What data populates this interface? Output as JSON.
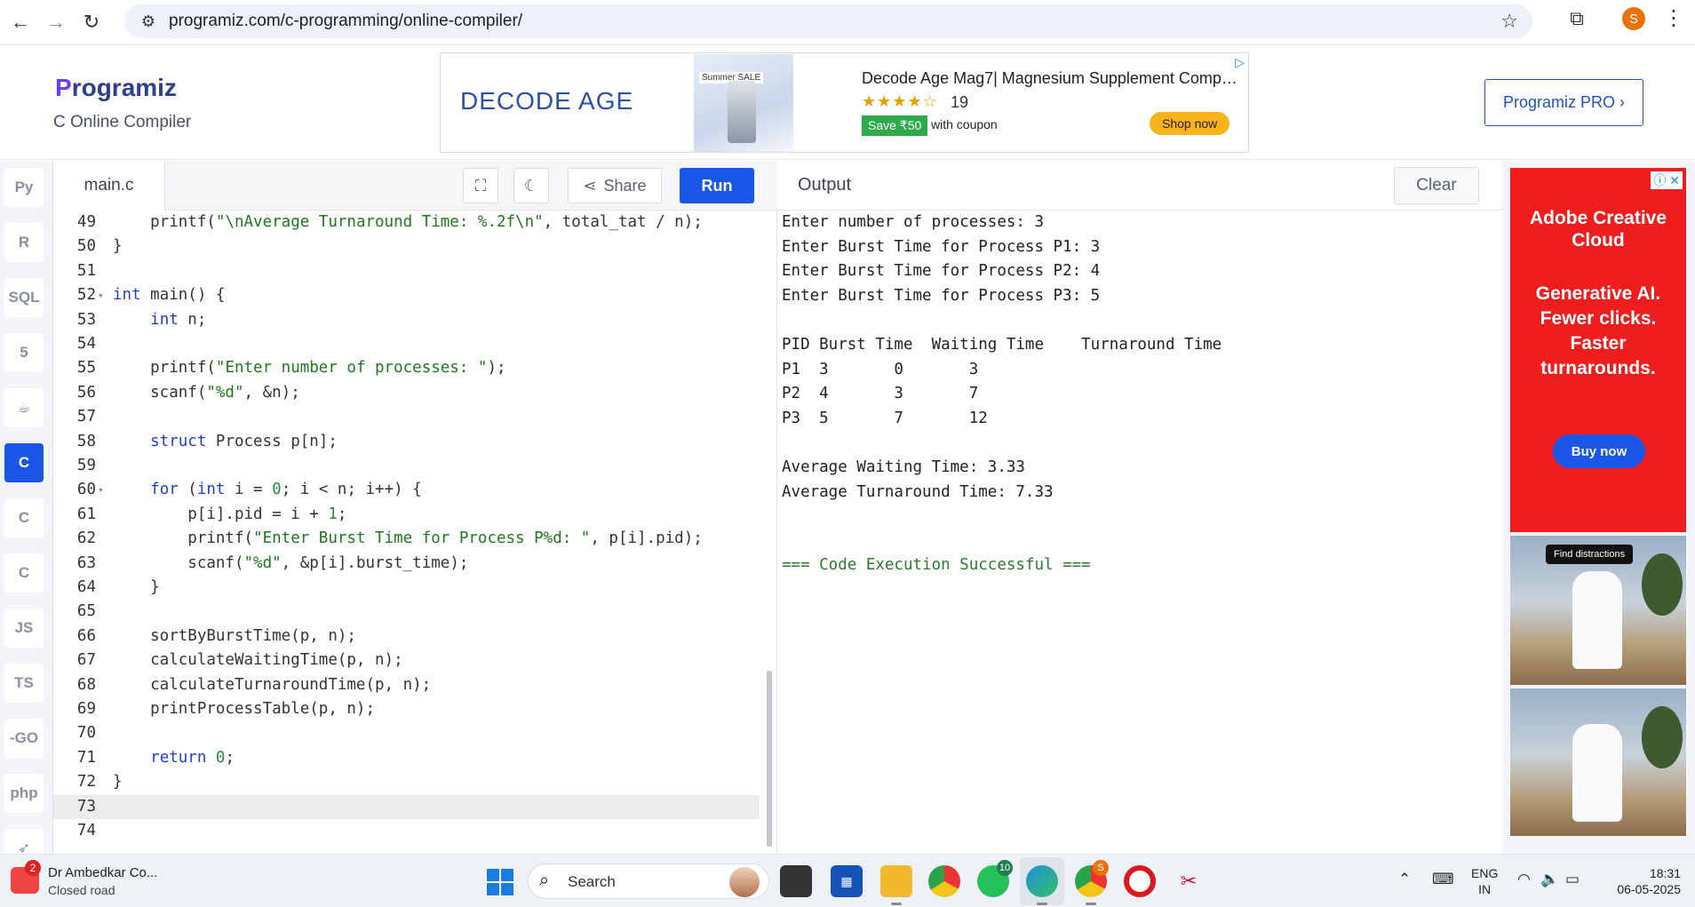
{
  "browser": {
    "url": "programiz.com/c-programming/online-compiler/",
    "profile_initial": "S"
  },
  "header": {
    "logo_p": "P",
    "logo_rest": "rogramiz",
    "subtitle": "C Online Compiler",
    "pro_button": "Programiz PRO ›"
  },
  "top_ad": {
    "brand": "DECODE AGE",
    "product_tag": "Summer SALE",
    "title": "Decode Age Mag7| Magnesium Supplement Comp…",
    "stars": "★★★★☆",
    "review_count": "19",
    "save_badge": "Save ₹50",
    "coupon_text": "with coupon",
    "shop_button": "Shop now"
  },
  "sidebar": {
    "languages": [
      {
        "id": "python",
        "label": "Py"
      },
      {
        "id": "r",
        "label": "R"
      },
      {
        "id": "sql",
        "label": "SQL"
      },
      {
        "id": "html",
        "label": "5"
      },
      {
        "id": "java",
        "label": "☕"
      },
      {
        "id": "c",
        "label": "C",
        "active": true
      },
      {
        "id": "cpp",
        "label": "C"
      },
      {
        "id": "csharp",
        "label": "C"
      },
      {
        "id": "js",
        "label": "JS"
      },
      {
        "id": "ts",
        "label": "TS"
      },
      {
        "id": "go",
        "label": "-GO"
      },
      {
        "id": "php",
        "label": "php"
      },
      {
        "id": "swift",
        "label": "➶"
      }
    ]
  },
  "editor": {
    "filename": "main.c",
    "share_label": "Share",
    "run_label": "Run",
    "lines": [
      {
        "n": "49",
        "html": "    printf(<span class=\"s\">\"\\nAverage Turnaround Time: %.2f\\n\"</span>, total_tat / n);"
      },
      {
        "n": "50",
        "html": "}"
      },
      {
        "n": "51",
        "html": ""
      },
      {
        "n": "52",
        "fold": true,
        "html": "<span class=\"k\">int</span> main() {"
      },
      {
        "n": "53",
        "html": "    <span class=\"k\">int</span> n;"
      },
      {
        "n": "54",
        "html": ""
      },
      {
        "n": "55",
        "html": "    printf(<span class=\"s\">\"Enter number of processes: \"</span>);"
      },
      {
        "n": "56",
        "html": "    scanf(<span class=\"s\">\"%d\"</span>, &amp;n);"
      },
      {
        "n": "57",
        "html": ""
      },
      {
        "n": "58",
        "html": "    <span class=\"k\">struct</span> Process p[n];"
      },
      {
        "n": "59",
        "html": ""
      },
      {
        "n": "60",
        "fold": true,
        "html": "    <span class=\"k\">for</span> (<span class=\"k\">int</span> i = <span class=\"n\">0</span>; i &lt; n; i++) {"
      },
      {
        "n": "61",
        "html": "        p[i].pid = i + <span class=\"n\">1</span>;"
      },
      {
        "n": "62",
        "html": "        printf(<span class=\"s\">\"Enter Burst Time for Process P%d: \"</span>, p[i].pid);"
      },
      {
        "n": "63",
        "html": "        scanf(<span class=\"s\">\"%d\"</span>, &amp;p[i].burst_time);"
      },
      {
        "n": "64",
        "html": "    }"
      },
      {
        "n": "65",
        "html": ""
      },
      {
        "n": "66",
        "html": "    sortByBurstTime(p, n);"
      },
      {
        "n": "67",
        "html": "    calculateWaitingTime(p, n);"
      },
      {
        "n": "68",
        "html": "    calculateTurnaroundTime(p, n);"
      },
      {
        "n": "69",
        "html": "    printProcessTable(p, n);"
      },
      {
        "n": "70",
        "html": ""
      },
      {
        "n": "71",
        "html": "    <span class=\"k\">return</span> <span class=\"n\">0</span>;"
      },
      {
        "n": "72",
        "html": "}"
      },
      {
        "n": "73",
        "current": true,
        "html": ""
      },
      {
        "n": "74",
        "html": ""
      }
    ]
  },
  "output": {
    "title": "Output",
    "clear_label": "Clear",
    "lines": [
      "Enter number of processes: 3",
      "Enter Burst Time for Process P1: 3",
      "Enter Burst Time for Process P2: 4",
      "Enter Burst Time for Process P3: 5",
      "",
      "PID Burst Time  Waiting Time    Turnaround Time",
      "P1  3       0       3",
      "P2  4       3       7",
      "P3  5       7       12",
      "",
      "Average Waiting Time: 3.33",
      "Average Turnaround Time: 7.33",
      "",
      "",
      "=== Code Execution Successful ==="
    ]
  },
  "side_ad": {
    "brand_line": "Adobe Creative Cloud",
    "tagline": "Generative AI. Fewer clicks. Faster turnarounds.",
    "buy_button": "Buy now",
    "pill": "Find distractions"
  },
  "taskbar": {
    "weather_badge": "2",
    "weather_title": "Dr Ambedkar Co...",
    "weather_sub": "Closed road",
    "search_label": "Search",
    "whatsapp_badge": "10",
    "chrome_badge": "S",
    "lang_top": "ENG",
    "lang_bottom": "IN",
    "time": "18:31",
    "date": "06-05-2025"
  },
  "colors": {
    "accent": "#1a56e8",
    "adobe_red": "#ef1d1d"
  }
}
